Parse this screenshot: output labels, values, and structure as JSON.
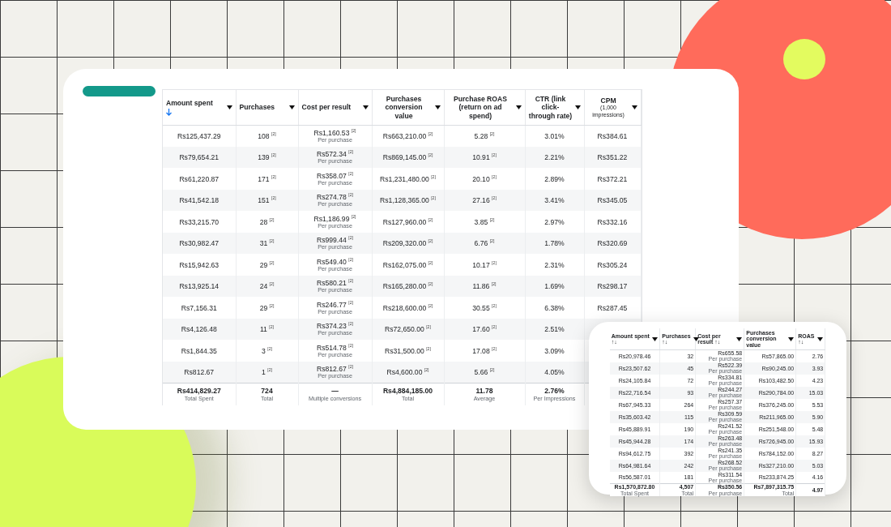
{
  "main_table": {
    "columns": [
      {
        "label": "Amount spent",
        "sorted": true
      },
      {
        "label": "Purchases",
        "sorted": false
      },
      {
        "label": "Cost per result",
        "sorted": false
      },
      {
        "label": "Purchases conversion value",
        "sorted": false
      },
      {
        "label": "Purchase ROAS (return on ad spend)",
        "sorted": false
      },
      {
        "label": "CTR (link click-through rate)",
        "sorted": false
      },
      {
        "label": "CPM",
        "sublabel": "(1,000 impressions)",
        "sorted": false
      }
    ],
    "rows": [
      {
        "cells": [
          {
            "text": "Rs125,437.29"
          },
          {
            "text": "108 $^{[2]}$"
          },
          {
            "text": "Rs1,160.53 $^{[2]}$",
            "note": "Per purchase"
          },
          {
            "text": "Rs663,210.00 $^{[2]}$"
          },
          {
            "text": "5.28 $^{[2]}$"
          },
          {
            "text": "3.01%"
          },
          {
            "text": "Rs384.61"
          }
        ]
      },
      {
        "cells": [
          {
            "text": "Rs79,654.21"
          },
          {
            "text": "139 $^{[2]}$"
          },
          {
            "text": "Rs572.34 $^{[2]}$",
            "note": "Per purchase"
          },
          {
            "text": "Rs869,145.00 $^{[2]}$"
          },
          {
            "text": "10.91 $^{[2]}$"
          },
          {
            "text": "2.21%"
          },
          {
            "text": "Rs351.22"
          }
        ]
      },
      {
        "cells": [
          {
            "text": "Rs61,220.87"
          },
          {
            "text": "171 $^{[2]}$"
          },
          {
            "text": "Rs358.07 $^{[2]}$",
            "note": "Per purchase"
          },
          {
            "text": "Rs1,231,480.00 $^{[2]}$"
          },
          {
            "text": "20.10 $^{[2]}$"
          },
          {
            "text": "2.89%"
          },
          {
            "text": "Rs372.21"
          }
        ]
      },
      {
        "cells": [
          {
            "text": "Rs41,542.18"
          },
          {
            "text": "151 $^{[2]}$"
          },
          {
            "text": "Rs274.78 $^{[2]}$",
            "note": "Per purchase"
          },
          {
            "text": "Rs1,128,365.00 $^{[2]}$"
          },
          {
            "text": "27.16 $^{[2]}$"
          },
          {
            "text": "3.41%"
          },
          {
            "text": "Rs345.05"
          }
        ]
      },
      {
        "cells": [
          {
            "text": "Rs33,215.70"
          },
          {
            "text": "28 $^{[2]}$"
          },
          {
            "text": "Rs1,186.99 $^{[2]}$",
            "note": "Per purchase"
          },
          {
            "text": "Rs127,960.00 $^{[2]}$"
          },
          {
            "text": "3.85 $^{[2]}$"
          },
          {
            "text": "2.97%"
          },
          {
            "text": "Rs332.16"
          }
        ]
      },
      {
        "cells": [
          {
            "text": "Rs30,982.47"
          },
          {
            "text": "31 $^{[2]}$"
          },
          {
            "text": "Rs999.44 $^{[2]}$",
            "note": "Per purchase"
          },
          {
            "text": "Rs209,320.00 $^{[2]}$"
          },
          {
            "text": "6.76 $^{[2]}$"
          },
          {
            "text": "1.78%"
          },
          {
            "text": "Rs320.69"
          }
        ]
      },
      {
        "cells": [
          {
            "text": "Rs15,942.63"
          },
          {
            "text": "29 $^{[2]}$"
          },
          {
            "text": "Rs549.40 $^{[2]}$",
            "note": "Per purchase"
          },
          {
            "text": "Rs162,075.00 $^{[2]}$"
          },
          {
            "text": "10.17 $^{[2]}$"
          },
          {
            "text": "2.31%"
          },
          {
            "text": "Rs305.24"
          }
        ]
      },
      {
        "cells": [
          {
            "text": "Rs13,925.14"
          },
          {
            "text": "24 $^{[2]}$"
          },
          {
            "text": "Rs580.21 $^{[2]}$",
            "note": "Per purchase"
          },
          {
            "text": "Rs165,280.00 $^{[2]}$"
          },
          {
            "text": "11.86 $^{[2]}$"
          },
          {
            "text": "1.69%"
          },
          {
            "text": "Rs298.17"
          }
        ]
      },
      {
        "cells": [
          {
            "text": "Rs7,156.31"
          },
          {
            "text": "29 $^{[2]}$"
          },
          {
            "text": "Rs246.77 $^{[2]}$",
            "note": "Per purchase"
          },
          {
            "text": "Rs218,600.00 $^{[2]}$"
          },
          {
            "text": "30.55 $^{[2]}$"
          },
          {
            "text": "6.38%"
          },
          {
            "text": "Rs287.45"
          }
        ]
      },
      {
        "cells": [
          {
            "text": "Rs4,126.48"
          },
          {
            "text": "11 $^{[2]}$"
          },
          {
            "text": "Rs374.23 $^{[2]}$",
            "note": "Per purchase"
          },
          {
            "text": "Rs72,650.00 $^{[2]}$"
          },
          {
            "text": "17.60 $^{[2]}$"
          },
          {
            "text": "2.51%"
          }
        ]
      },
      {
        "cells": [
          {
            "text": "Rs1,844.35"
          },
          {
            "text": "3 $^{[2]}$"
          },
          {
            "text": "Rs514.78 $^{[2]}$",
            "note": "Per purchase"
          },
          {
            "text": "Rs31,500.00 $^{[2]}$"
          },
          {
            "text": "17.08 $^{[2]}$"
          },
          {
            "text": "3.09%"
          }
        ]
      },
      {
        "cells": [
          {
            "text": "Rs812.67"
          },
          {
            "text": "1 $^{[2]}$"
          },
          {
            "text": "Rs812.67 $^{[2]}$",
            "note": "Per purchase"
          },
          {
            "text": "Rs4,600.00 $^{[2]}$"
          },
          {
            "text": "5.66 $^{[2]}$"
          },
          {
            "text": "4.05%"
          }
        ]
      }
    ],
    "totals": [
      {
        "text": "Rs414,829.27",
        "note": "Total Spent"
      },
      {
        "text": "724",
        "note": "Total"
      },
      {
        "text": "—",
        "note": "Multiple conversions"
      },
      {
        "text": "Rs4,884,185.00",
        "note": "Total"
      },
      {
        "text": "11.78",
        "note": "Average"
      },
      {
        "text": "2.76%",
        "note": "Per Impressions"
      }
    ]
  },
  "inset_table": {
    "columns": [
      {
        "label": "Amount spent ↑↓"
      },
      {
        "label": "Purchases ↑↓"
      },
      {
        "label": "Cost per result ↑↓"
      },
      {
        "label": "Purchases conversion value"
      },
      {
        "label": "ROAS ↑↓"
      }
    ],
    "rows": [
      {
        "cells": [
          {
            "text": "Rs20,978.46"
          },
          {
            "text": "32"
          },
          {
            "text": "Rs655.58",
            "note": "Per purchase"
          },
          {
            "text": "Rs57,865.00"
          },
          {
            "text": "2.76"
          }
        ]
      },
      {
        "cells": [
          {
            "text": "Rs23,507.62"
          },
          {
            "text": "45"
          },
          {
            "text": "Rs522.39",
            "note": "Per purchase"
          },
          {
            "text": "Rs90,245.00"
          },
          {
            "text": "3.93"
          }
        ]
      },
      {
        "cells": [
          {
            "text": "Rs24,105.84"
          },
          {
            "text": "72"
          },
          {
            "text": "Rs334.81",
            "note": "Per purchase"
          },
          {
            "text": "Rs103,482.50"
          },
          {
            "text": "4.23"
          }
        ]
      },
      {
        "cells": [
          {
            "text": "Rs22,716.54"
          },
          {
            "text": "93"
          },
          {
            "text": "Rs244.27",
            "note": "Per purchase"
          },
          {
            "text": "Rs290,784.00"
          },
          {
            "text": "15.03"
          }
        ]
      },
      {
        "cells": [
          {
            "text": "Rs67,945.33"
          },
          {
            "text": "264"
          },
          {
            "text": "Rs257.37",
            "note": "Per purchase"
          },
          {
            "text": "Rs376,245.00"
          },
          {
            "text": "5.53"
          }
        ]
      },
      {
        "cells": [
          {
            "text": "Rs35,603.42"
          },
          {
            "text": "115"
          },
          {
            "text": "Rs309.59",
            "note": "Per purchase"
          },
          {
            "text": "Rs211,965.00"
          },
          {
            "text": "5.90"
          }
        ]
      },
      {
        "cells": [
          {
            "text": "Rs45,889.91"
          },
          {
            "text": "190"
          },
          {
            "text": "Rs241.52",
            "note": "Per purchase"
          },
          {
            "text": "Rs251,548.00"
          },
          {
            "text": "5.48"
          }
        ]
      },
      {
        "cells": [
          {
            "text": "Rs45,944.28"
          },
          {
            "text": "174"
          },
          {
            "text": "Rs263.48",
            "note": "Per purchase"
          },
          {
            "text": "Rs726,945.00"
          },
          {
            "text": "15.93"
          }
        ]
      },
      {
        "cells": [
          {
            "text": "Rs94,612.75"
          },
          {
            "text": "392"
          },
          {
            "text": "Rs241.35",
            "note": "Per purchase"
          },
          {
            "text": "Rs784,152.00"
          },
          {
            "text": "8.27"
          }
        ]
      },
      {
        "cells": [
          {
            "text": "Rs64,981.64"
          },
          {
            "text": "242"
          },
          {
            "text": "Rs268.52",
            "note": "Per purchase"
          },
          {
            "text": "Rs327,210.00"
          },
          {
            "text": "5.03"
          }
        ]
      },
      {
        "cells": [
          {
            "text": "Rs56,587.01"
          },
          {
            "text": "181"
          },
          {
            "text": "Rs311.54",
            "note": "Per purchase"
          },
          {
            "text": "Rs233,874.25"
          },
          {
            "text": "4.16"
          }
        ]
      }
    ],
    "totals": [
      {
        "text": "Rs1,570,872.80",
        "note": "Total Spent"
      },
      {
        "text": "4,507",
        "note": "Total"
      },
      {
        "text": "Rs350.56",
        "note": "Per purchase"
      },
      {
        "text": "Rs7,897,315.75",
        "note": "Total"
      },
      {
        "text": "4.97"
      }
    ]
  }
}
